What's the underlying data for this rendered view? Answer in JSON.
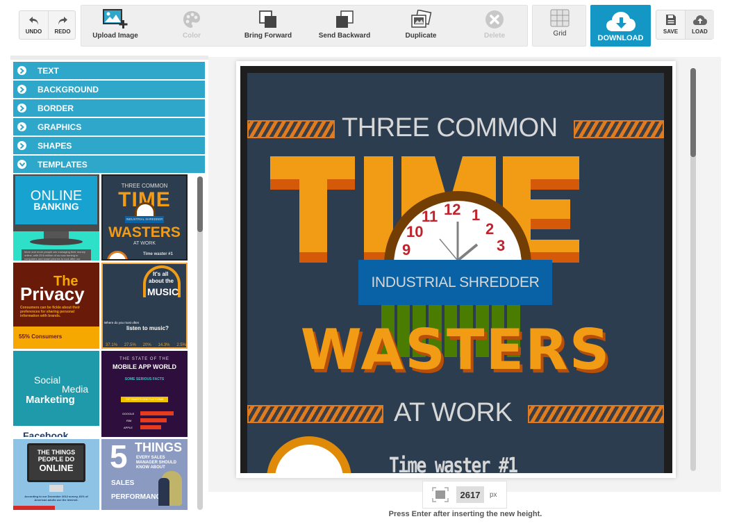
{
  "toolbar": {
    "undo": "UNDO",
    "redo": "REDO",
    "upload_image": "Upload Image",
    "color": "Color",
    "bring_forward": "Bring Forward",
    "send_backward": "Send Backward",
    "duplicate": "Duplicate",
    "delete": "Delete",
    "grid": "Grid",
    "download": "DOWNLOAD",
    "save": "SAVE",
    "load": "LOAD",
    "disabled": [
      "Color",
      "Delete"
    ],
    "accent_color": "#1597c5"
  },
  "sidebar": {
    "sections": [
      {
        "label": "TEXT",
        "expanded": false
      },
      {
        "label": "BACKGROUND",
        "expanded": false
      },
      {
        "label": "BORDER",
        "expanded": false
      },
      {
        "label": "GRAPHICS",
        "expanded": false
      },
      {
        "label": "SHAPES",
        "expanded": false
      },
      {
        "label": "TEMPLATES",
        "expanded": true
      }
    ],
    "accent_color": "#2fa7ca",
    "templates": [
      {
        "name": "online-banking",
        "line1": "ONLINE",
        "line2": "BANKING",
        "caption": "More and more people are managing their money online, with 25.6 million of us now turning to computers and smart phones to look after our finances."
      },
      {
        "name": "time-wasters",
        "line1": "THREE COMMON",
        "line2": "TIME",
        "line3": "INDUSTRIAL SHREDDER",
        "line4": "WASTERS",
        "line5": "AT WORK",
        "line6": "Time waster #1"
      },
      {
        "name": "privacy",
        "line1": "The",
        "line2": "Privacy",
        "caption": "Consumers can be fickle about their preferences for sharing personal information with brands.",
        "stat": "55% Consumers"
      },
      {
        "name": "music",
        "line1": "It's all",
        "line2": "about the",
        "line3": "MUSIC",
        "question_small": "Where do you most often",
        "question": "listen to music?",
        "stats": [
          "37.1%",
          "27.5%",
          "20%",
          "14.3%",
          "2.5%"
        ]
      },
      {
        "name": "social-media",
        "line1": "Social",
        "line2": "Media",
        "line3": "Marketing",
        "footer": "Facebook"
      },
      {
        "name": "mobile-app-world",
        "line1": "THE STATE OF THE",
        "line2": "MOBILE APP WORLD",
        "line3": "SOME SERIOUS FACTS",
        "banner": "TOP SMARTPHONE PLATFORMS",
        "bars": [
          {
            "label": "GOOGLE",
            "value": "51.2%"
          },
          {
            "label": "RIM",
            "value": "38.14%"
          },
          {
            "label": "APPLE",
            "value": "24.7%"
          }
        ]
      },
      {
        "name": "things-online",
        "line1": "THE THINGS",
        "line2": "PEOPLE DO",
        "line3": "ONLINE",
        "caption": "According to our December 2012 survey, 81% of American adults use the internet."
      },
      {
        "name": "sales-things",
        "line1": "5",
        "line2": "THINGS",
        "line3": "EVERY SALES MANAGER SHOULD KNOW ABOUT",
        "line4": "SALES",
        "line5": "PERFORMANCE"
      }
    ]
  },
  "canvas": {
    "infographic": {
      "headline_top": "THREE COMMON",
      "headline_big": "TIME",
      "clock_numbers": [
        "9",
        "10",
        "11",
        "12",
        "1",
        "2",
        "3"
      ],
      "shredder_label": "INDUSTRIAL SHREDDER",
      "headline_mid": "WASTERS",
      "headline_bottom": "AT WORK",
      "section_title": "Time waster #1",
      "colors": {
        "background": "#2d3d50",
        "orange": "#f29b15",
        "orange_shadow": "#d45a0a",
        "blue": "#0862a5",
        "green": "#4a7c02",
        "clock_rim": "#733e04",
        "clock_numbers": "#c0232b"
      }
    },
    "height": {
      "value": "2617",
      "unit": "px",
      "hint": "Press Enter after inserting the new height."
    }
  }
}
